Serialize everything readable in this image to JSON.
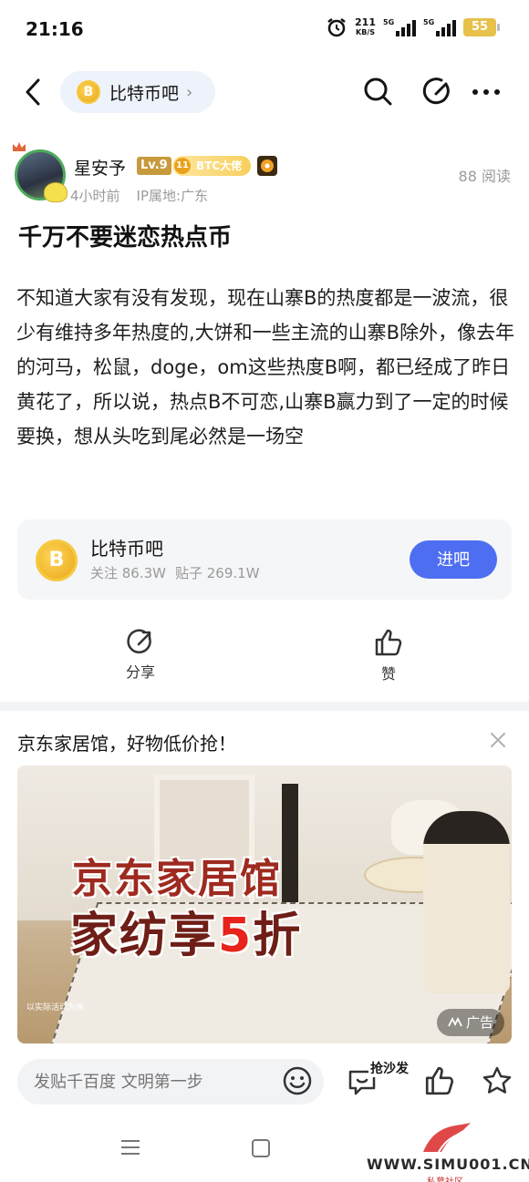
{
  "status_bar": {
    "time": "21:16",
    "net_speed": "211",
    "net_unit": "KB/S",
    "signal1": "5G",
    "signal2": "5G",
    "battery": "55"
  },
  "nav": {
    "forum_name": "比特币吧",
    "forum_icon_letter": "B"
  },
  "author": {
    "name": "星安予",
    "level": "Lv.9",
    "badge_level": "11",
    "badge_label": "BTC大佬",
    "time": "4小时前",
    "ip": "IP属地:广东",
    "views": "88 阅读"
  },
  "post": {
    "title": "千万不要迷恋热点币",
    "body": "不知道大家有没有发现，现在山寨B的热度都是一波流，很少有维持多年热度的,大饼和一些主流的山寨B除外，像去年的河马，松鼠，doge，om这些热度B啊，都已经成了昨日黄花了，所以说，热点B不可恋,山寨B赢力到了一定的时候要换，想从头吃到尾必然是一场空"
  },
  "forum_card": {
    "name": "比特币吧",
    "followers": "关注 86.3W",
    "posts": "贴子 269.1W",
    "enter": "进吧"
  },
  "actions": {
    "share": "分享",
    "like": "赞"
  },
  "ad": {
    "title": "京东家居馆，好物低价抢！",
    "headline1": "京东家居馆",
    "headline2_pre": "家纺享",
    "headline2_hl": "5",
    "headline2_post": "折",
    "note": "以实际活动为准",
    "badge": "广告"
  },
  "bottom_bar": {
    "reply_placeholder": "发贴千百度 文明第一步",
    "sofa_label": "抢沙发"
  },
  "watermark": {
    "domain": "WWW.SIMU001.CN",
    "sub": "私募社区"
  },
  "colors": {
    "accent": "#4e6ef2",
    "coin": "#f0b429",
    "level_badge": "#c79a3e"
  }
}
